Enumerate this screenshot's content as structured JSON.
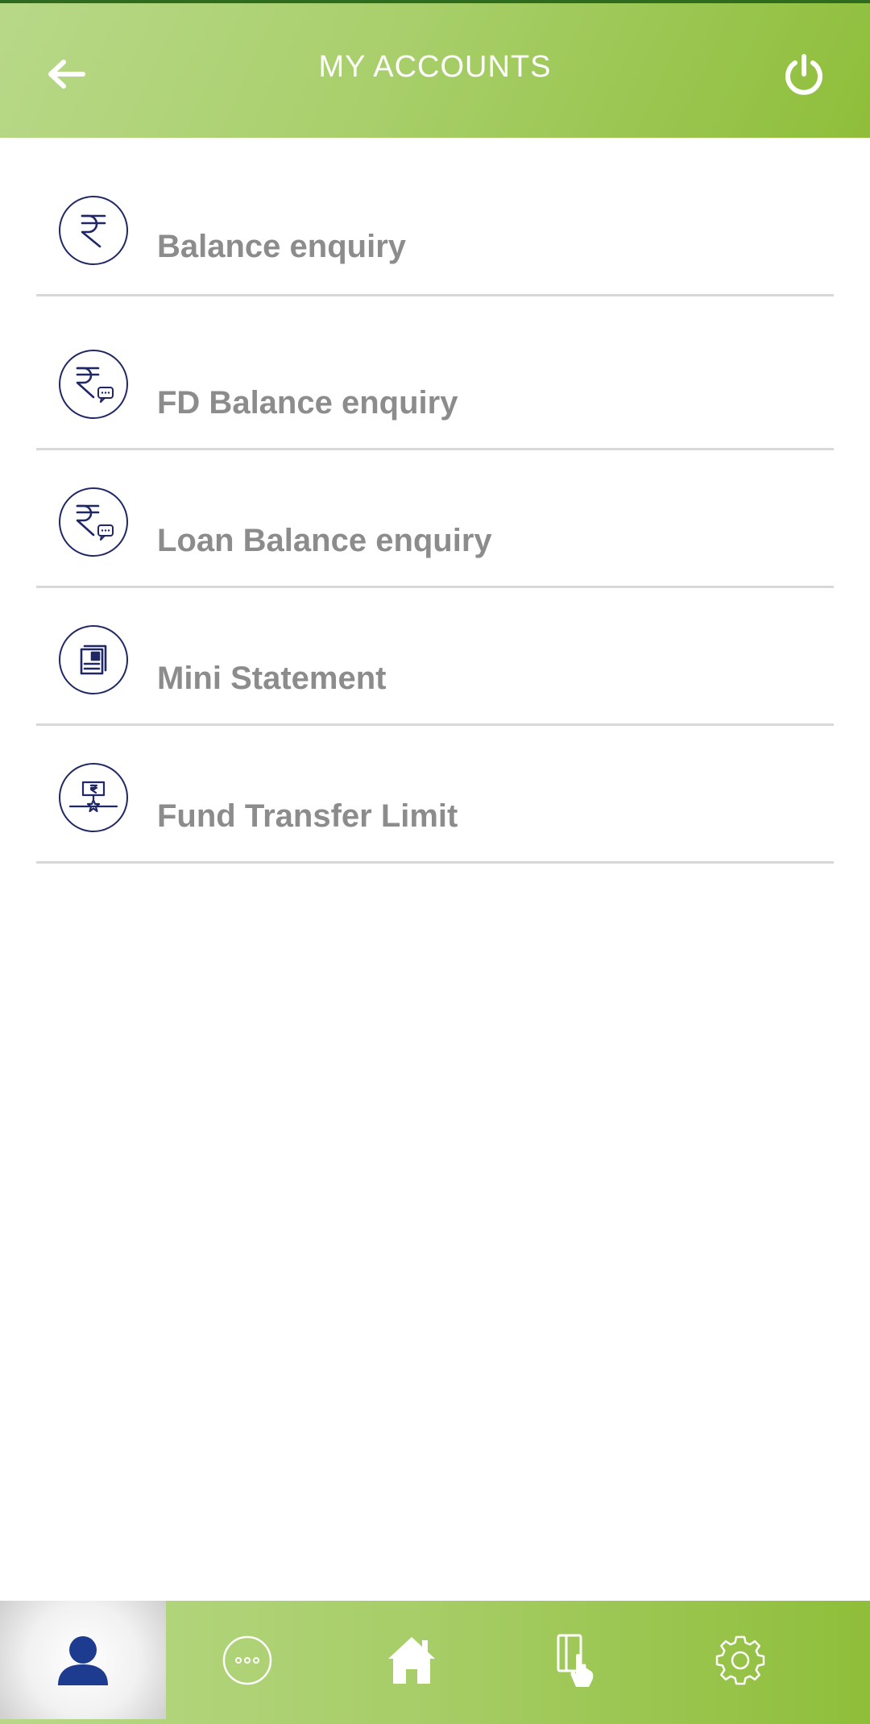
{
  "header": {
    "title": "MY ACCOUNTS",
    "back_icon": "arrow-left-icon",
    "logout_icon": "power-icon"
  },
  "menu": {
    "items": [
      {
        "label": "Balance enquiry",
        "icon": "rupee-icon"
      },
      {
        "label": "FD Balance enquiry",
        "icon": "rupee-chat-icon"
      },
      {
        "label": "Loan Balance enquiry",
        "icon": "rupee-chat-icon"
      },
      {
        "label": "Mini Statement",
        "icon": "statement-icon"
      },
      {
        "label": "Fund Transfer Limit",
        "icon": "transfer-limit-icon"
      }
    ]
  },
  "bottom_nav": {
    "items": [
      {
        "icon": "user-icon",
        "active": true
      },
      {
        "icon": "more-icon",
        "active": false
      },
      {
        "icon": "home-icon",
        "active": false
      },
      {
        "icon": "card-tap-icon",
        "active": false
      },
      {
        "icon": "gear-icon",
        "active": false
      }
    ]
  },
  "colors": {
    "header_green": "#a8cf6b",
    "icon_navy": "#1f2766",
    "label_gray": "#8c8c8c",
    "active_user_icon": "#1d3b8f"
  }
}
